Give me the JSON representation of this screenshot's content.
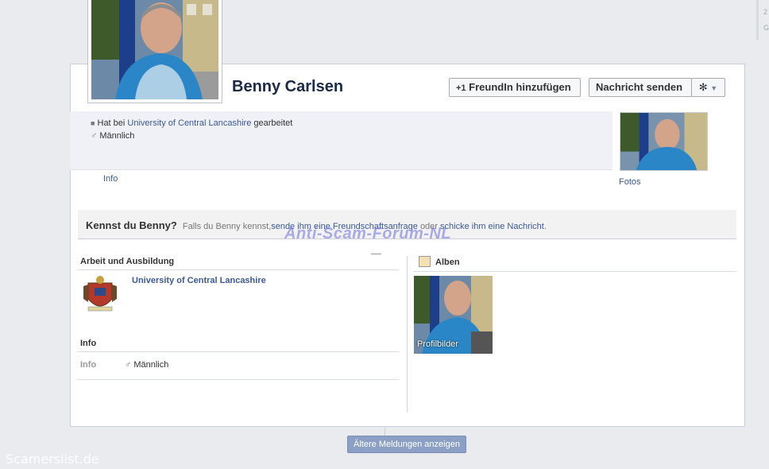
{
  "right_rail": {
    "line1": "2",
    "line2": "G"
  },
  "profile": {
    "name": "Benny Carlsen"
  },
  "actions": {
    "add_friend": "FreundIn hinzufügen",
    "send_message": "Nachricht senden"
  },
  "about": {
    "work_prefix": "Hat bei",
    "work_org": "University of Central Lancashire",
    "work_suffix": "gearbeitet",
    "gender": "Männlich",
    "info_link": "Info"
  },
  "photos_link": "Fotos",
  "know_prompt": {
    "title": "Kennst du Benny?",
    "text1": "Falls du Benny kennst,",
    "link1": "sende ihm eine Freundschaftsanfrage",
    "text2": "oder",
    "link2": "schicke ihm eine Nachricht",
    "text3": "."
  },
  "work_section": {
    "heading": "Arbeit und Ausbildung",
    "org": "University of Central Lancashire"
  },
  "info_section": {
    "heading": "Info",
    "label": "Info",
    "value": "Männlich"
  },
  "albums": {
    "heading": "Alben",
    "album1": "Profilbilder"
  },
  "older_posts": "Ältere Meldungen anzeigen",
  "watermark": "Anti-Scam-Forum-NL",
  "corner_watermark": "Scamerslist.de",
  "colors": {
    "link": "#3b5998",
    "name": "#1c2a47",
    "older_button": "#8c9fc4"
  }
}
